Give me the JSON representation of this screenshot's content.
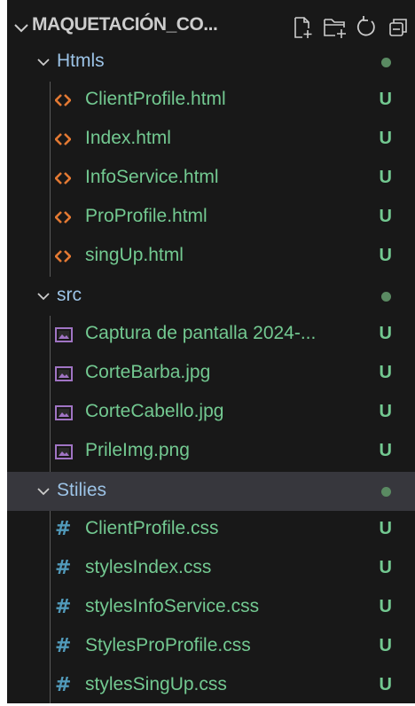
{
  "header": {
    "title": "MAQUETACIÓN_CO...",
    "actions": [
      {
        "name": "new-file-icon"
      },
      {
        "name": "new-folder-icon"
      },
      {
        "name": "refresh-icon"
      },
      {
        "name": "collapse-all-icon"
      }
    ]
  },
  "colors": {
    "background": "#181818",
    "selected_row": "#37373d",
    "untracked_green": "#73c991",
    "html_icon": "#e37933",
    "css_icon": "#519aba",
    "image_icon": "#a074c4"
  },
  "folders": [
    {
      "label": "Htmls",
      "status": "dot"
    },
    {
      "label": "src",
      "status": "dot"
    },
    {
      "label": "Stilies",
      "status": "dot"
    }
  ],
  "files": {
    "htmls": [
      {
        "label": "ClientProfile.html",
        "status": "U",
        "icon": "html-icon"
      },
      {
        "label": "Index.html",
        "status": "U",
        "icon": "html-icon"
      },
      {
        "label": "InfoService.html",
        "status": "U",
        "icon": "html-icon"
      },
      {
        "label": "ProProfile.html",
        "status": "U",
        "icon": "html-icon"
      },
      {
        "label": "singUp.html",
        "status": "U",
        "icon": "html-icon"
      }
    ],
    "src": [
      {
        "label": "Captura de pantalla 2024-...",
        "status": "U",
        "icon": "image-icon"
      },
      {
        "label": "CorteBarba.jpg",
        "status": "U",
        "icon": "image-icon"
      },
      {
        "label": "CorteCabello.jpg",
        "status": "U",
        "icon": "image-icon"
      },
      {
        "label": "PrileImg.png",
        "status": "U",
        "icon": "image-icon"
      }
    ],
    "stilies": [
      {
        "label": "ClientProfile.css",
        "status": "U",
        "icon": "css-hash-icon"
      },
      {
        "label": "stylesIndex.css",
        "status": "U",
        "icon": "css-hash-icon"
      },
      {
        "label": "stylesInfoService.css",
        "status": "U",
        "icon": "css-hash-icon"
      },
      {
        "label": "StylesProProfile.css",
        "status": "U",
        "icon": "css-hash-icon"
      },
      {
        "label": "stylesSingUp.css",
        "status": "U",
        "icon": "css-hash-icon"
      }
    ]
  }
}
